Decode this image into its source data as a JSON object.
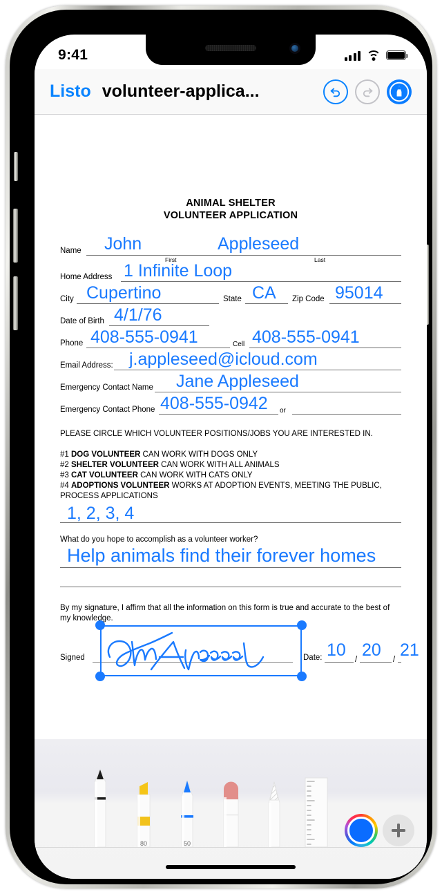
{
  "status_bar": {
    "time": "9:41",
    "cellular_icon": "signal-bars-icon",
    "wifi_icon": "wifi-icon",
    "battery_icon": "battery-icon"
  },
  "nav_bar": {
    "done_label": "Listo",
    "title": "volunteer-applica...",
    "undo_icon": "undo-arrow-icon",
    "redo_icon": "redo-arrow-icon",
    "markup_icon": "markup-pen-icon"
  },
  "document": {
    "title_line1": "ANIMAL SHELTER",
    "title_line2": "VOLUNTEER APPLICATION",
    "fields": {
      "name_label": "Name",
      "name_first_value": "John",
      "name_last_value": "Appleseed",
      "first_caption": "First",
      "last_caption": "Last",
      "home_address_label": "Home Address",
      "home_address_value": "1 Infinite Loop",
      "city_label": "City",
      "city_value": "Cupertino",
      "state_label": "State",
      "state_value": "CA",
      "zip_label": "Zip Code",
      "zip_value": "95014",
      "dob_label": "Date of Birth",
      "dob_value": "4/1/76",
      "phone_label": "Phone",
      "phone_value": "408-555-0941",
      "cell_label": "Cell",
      "cell_value": "408-555-0941",
      "email_label": "Email Address:",
      "email_value": "j.appleseed@icloud.com",
      "emergency_name_label": "Emergency Contact Name",
      "emergency_name_value": "Jane Appleseed",
      "emergency_phone_label": "Emergency Contact Phone",
      "emergency_phone_value": "408-555-0942",
      "or_label": "or"
    },
    "instructions": "PLEASE CIRCLE WHICH VOLUNTEER POSITIONS/JOBS YOU ARE INTERESTED IN.",
    "positions": [
      {
        "num": "#1 ",
        "role": "DOG VOLUNTEER",
        "desc": " CAN WORK WITH DOGS ONLY"
      },
      {
        "num": "#2 ",
        "role": "SHELTER VOLUNTEER",
        "desc": " CAN WORK WITH ALL ANIMALS"
      },
      {
        "num": "#3 ",
        "role": "CAT VOLUNTEER",
        "desc": " CAN WORK WITH CATS ONLY"
      },
      {
        "num": "#4 ",
        "role": "ADOPTIONS VOLUNTEER",
        "desc": " WORKS AT ADOPTION EVENTS, MEETING THE PUBLIC, PROCESS APPLICATIONS"
      }
    ],
    "positions_answer": "1, 2, 3, 4",
    "goal_question": "What do you hope to accomplish as a volunteer worker?",
    "goal_answer": "Help animals find their forever homes",
    "affirmation": "By my signature, I affirm that all the information on this form is true and accurate to the best of my knowledge.",
    "signed_label": "Signed",
    "signature_value": "John Appleseed",
    "date_label": "Date:",
    "date_month": "10",
    "date_day": "20",
    "date_year": "21",
    "date_sep": "/"
  },
  "toolbar": {
    "tools": [
      {
        "name": "pen-tool",
        "label": ""
      },
      {
        "name": "highlighter-tool",
        "label": "80"
      },
      {
        "name": "marker-tool",
        "label": "50"
      },
      {
        "name": "eraser-tool",
        "label": ""
      },
      {
        "name": "lasso-tool",
        "label": ""
      },
      {
        "name": "ruler-tool",
        "label": ""
      }
    ],
    "color_well": "color-picker",
    "add_label": "+",
    "selected_color": "#0a6cff"
  },
  "colors": {
    "ink_blue": "#1a7aff",
    "system_blue": "#0a84ff",
    "disabled_gray": "#c2c2c7"
  }
}
